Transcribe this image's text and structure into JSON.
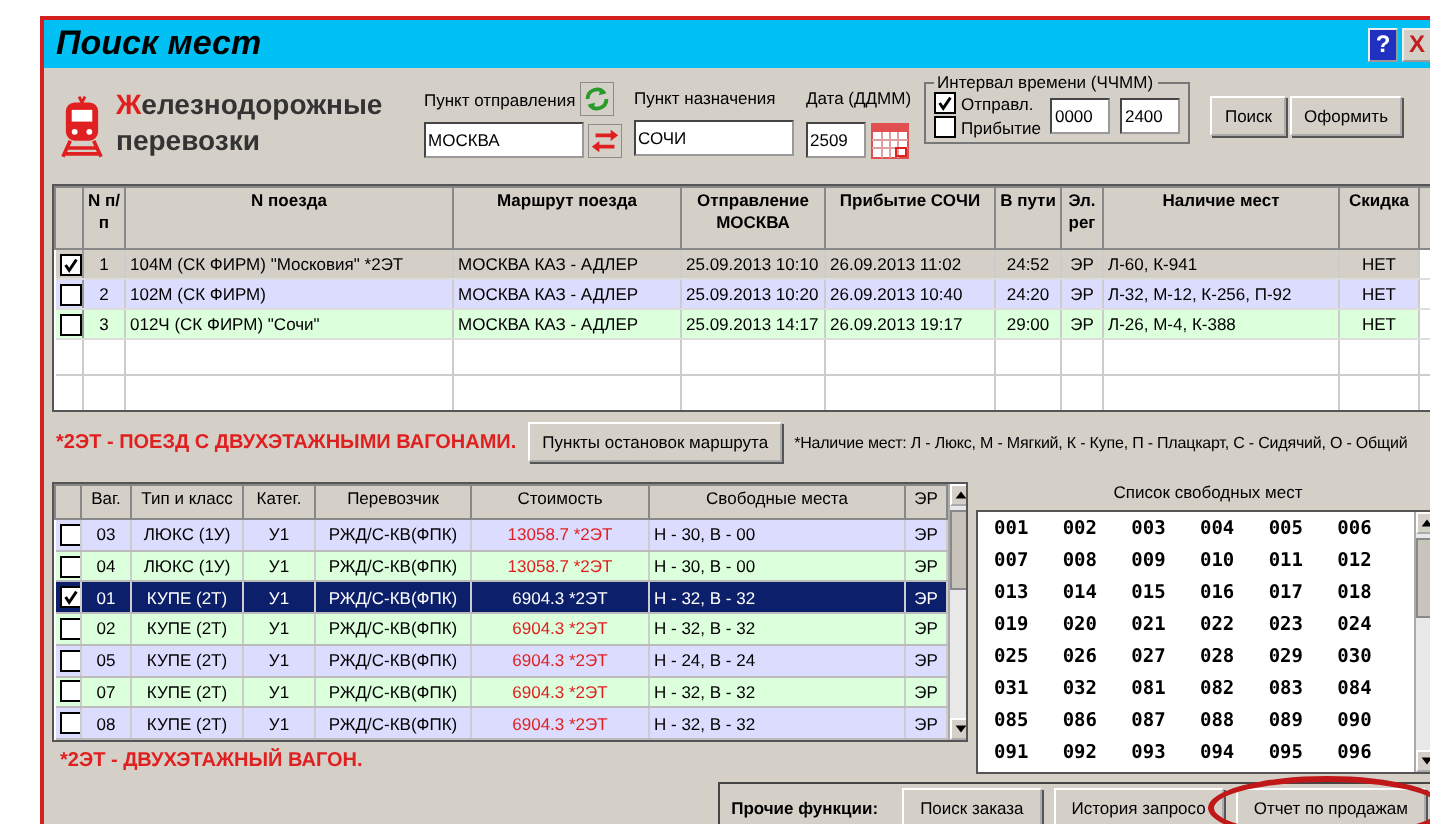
{
  "window": {
    "title": "Поиск мест",
    "help": "?",
    "close": "X"
  },
  "brand": {
    "title": "Железнодорожные",
    "subtitle": "перевозки"
  },
  "search": {
    "from_label": "Пункт отправления",
    "from_value": "МОСКВА",
    "to_label": "Пункт назначения",
    "to_value": "СОЧИ",
    "date_label": "Дата (ДДММ)",
    "date_value": "2509",
    "interval": {
      "title": "Интервал времени (ЧЧММ)",
      "options": [
        {
          "label": "Отправл.",
          "checked": true
        },
        {
          "label": "Прибытие",
          "checked": false
        }
      ],
      "from": "0000",
      "to": "2400"
    },
    "buttons": [
      "Поиск",
      "Оформить"
    ]
  },
  "trains": {
    "columns": [
      "N п/п",
      "N поезда",
      "Маршрут поезда",
      "Отправление МОСКВА",
      "Прибытие СОЧИ",
      "В пути",
      "Эл. рег",
      "Наличие мест",
      "Скидка"
    ],
    "rows": [
      {
        "checked": true,
        "cells": [
          "1",
          "104М  (СК ФИРМ)  \"Московия\"  *2ЭТ",
          "МОСКВА КАЗ - АДЛЕР",
          "25.09.2013  10:10",
          "26.09.2013  11:02",
          "24:52",
          "ЭР",
          "Л-60, К-941",
          "НЕТ"
        ]
      },
      {
        "checked": false,
        "cells": [
          "2",
          "102М  (СК ФИРМ)",
          "МОСКВА КАЗ - АДЛЕР",
          "25.09.2013  10:20",
          "26.09.2013  10:40",
          "24:20",
          "ЭР",
          "Л-32, М-12, К-256, П-92",
          "НЕТ"
        ]
      },
      {
        "checked": false,
        "cells": [
          "3",
          "012Ч  (СК ФИРМ)  \"Сочи\"",
          "МОСКВА КАЗ - АДЛЕР",
          "25.09.2013  14:17",
          "26.09.2013  19:17",
          "29:00",
          "ЭР",
          "Л-26, М-4, К-388",
          "НЕТ"
        ]
      }
    ],
    "footnote": "*2ЭТ - ПОЕЗД С ДВУХЭТАЖНЫМИ ВАГОНАМИ.",
    "stops_button": "Пункты остановок маршрута",
    "legend": "*Наличие мест:  Л - Люкс, М - Мягкий, К - Купе, П - Плацкарт,  С - Сидячий, О - Общий"
  },
  "cars": {
    "columns": [
      "Ваг.",
      "Тип и класс",
      "Катег.",
      "Перевозчик",
      "Стоимость",
      "Свободные места",
      "ЭР"
    ],
    "rows": [
      {
        "checked": false,
        "cells": [
          "03",
          "ЛЮКС (1У)",
          "У1",
          "РЖД/С-КВ(ФПК)",
          "13058.7 *2ЭТ",
          "Н - 30,  В - 00",
          "ЭР"
        ]
      },
      {
        "checked": false,
        "cells": [
          "04",
          "ЛЮКС (1У)",
          "У1",
          "РЖД/С-КВ(ФПК)",
          "13058.7 *2ЭТ",
          "Н - 30,  В - 00",
          "ЭР"
        ]
      },
      {
        "checked": true,
        "cells": [
          "01",
          "КУПЕ (2Т)",
          "У1",
          "РЖД/С-КВ(ФПК)",
          "6904.3 *2ЭТ",
          "Н - 32,  В - 32",
          "ЭР"
        ]
      },
      {
        "checked": false,
        "cells": [
          "02",
          "КУПЕ (2Т)",
          "У1",
          "РЖД/С-КВ(ФПК)",
          "6904.3 *2ЭТ",
          "Н - 32,  В - 32",
          "ЭР"
        ]
      },
      {
        "checked": false,
        "cells": [
          "05",
          "КУПЕ (2Т)",
          "У1",
          "РЖД/С-КВ(ФПК)",
          "6904.3 *2ЭТ",
          "Н - 24,  В - 24",
          "ЭР"
        ]
      },
      {
        "checked": false,
        "cells": [
          "07",
          "КУПЕ (2Т)",
          "У1",
          "РЖД/С-КВ(ФПК)",
          "6904.3 *2ЭТ",
          "Н - 32,  В - 32",
          "ЭР"
        ]
      },
      {
        "checked": false,
        "cells": [
          "08",
          "КУПЕ (2Т)",
          "У1",
          "РЖД/С-КВ(ФПК)",
          "6904.3 *2ЭТ",
          "Н - 32,  В - 32",
          "ЭР"
        ]
      }
    ],
    "footnote": "*2ЭТ - ДВУХЭТАЖНЫЙ ВАГОН."
  },
  "seats": {
    "title": "Список свободных мест",
    "numbers": [
      "001",
      "002",
      "003",
      "004",
      "005",
      "006",
      "007",
      "008",
      "009",
      "010",
      "011",
      "012",
      "013",
      "014",
      "015",
      "016",
      "017",
      "018",
      "019",
      "020",
      "021",
      "022",
      "023",
      "024",
      "025",
      "026",
      "027",
      "028",
      "029",
      "030",
      "031",
      "032",
      "081",
      "082",
      "083",
      "084",
      "085",
      "086",
      "087",
      "088",
      "089",
      "090",
      "091",
      "092",
      "093",
      "094",
      "095",
      "096"
    ]
  },
  "other_functions": {
    "label": "Прочие функции:",
    "buttons": [
      {
        "label": "Поиск заказа",
        "circled": false
      },
      {
        "label": "История запросо",
        "circled": false
      },
      {
        "label": "Отчет по продажам",
        "circled": true
      }
    ]
  }
}
